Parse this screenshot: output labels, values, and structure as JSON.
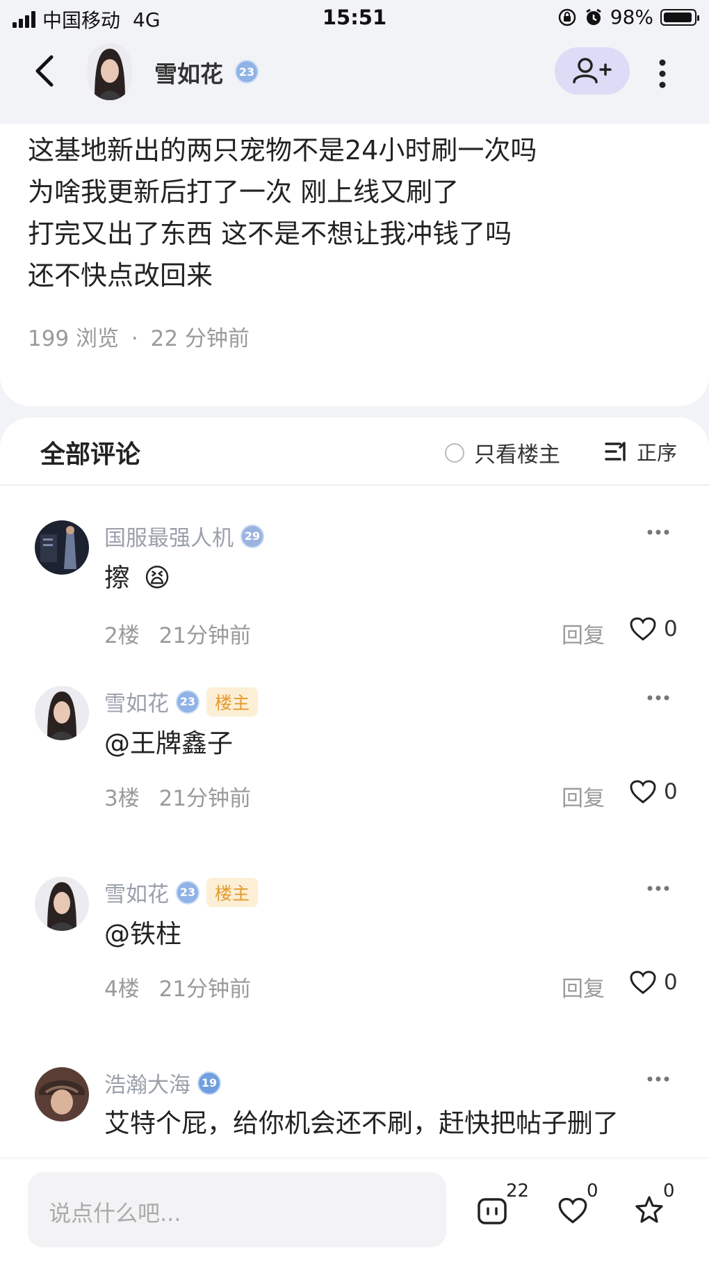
{
  "status": {
    "carrier": "中国移动",
    "network": "4G",
    "time": "15:51",
    "battery": "98%"
  },
  "header": {
    "username": "雪如花",
    "level": "23",
    "avatar_icon": "female-portrait-avatar",
    "follow_icon": "add-user-icon"
  },
  "post": {
    "lines": [
      "这基地新出的两只宠物不是24小时刷一次吗",
      "为啥我更新后打了一次 刚上线又刷了",
      "打完又出了东西 这不是不想让我冲钱了吗",
      "还不快点改回来"
    ],
    "views": "199 浏览",
    "separator": "·",
    "time": "22 分钟前"
  },
  "comments_section": {
    "title": "全部评论",
    "only_op_label": "只看楼主",
    "sort_label": "正序",
    "items": [
      {
        "name": "国服最强人机",
        "level": "29",
        "level_color": "#9cb3e0",
        "is_op": false,
        "text": "擦",
        "emoji": "😫",
        "floor": "2楼",
        "time": "21分钟前",
        "reply": "回复",
        "likes": "0",
        "avatar_color": "#1d2230"
      },
      {
        "name": "雪如花",
        "level": "23",
        "level_color": "#8fb3e6",
        "is_op": true,
        "op_label": "楼主",
        "text": "@王牌鑫子",
        "floor": "3楼",
        "time": "21分钟前",
        "reply": "回复",
        "likes": "0",
        "avatar_color": "#e9e9ee"
      },
      {
        "name": "雪如花",
        "level": "23",
        "level_color": "#8fb3e6",
        "is_op": true,
        "op_label": "楼主",
        "text": "@铁柱",
        "floor": "4楼",
        "time": "21分钟前",
        "reply": "回复",
        "likes": "0",
        "avatar_color": "#e9e9ee"
      },
      {
        "name": "浩瀚大海",
        "level": "19",
        "level_color": "#6f9fe0",
        "is_op": false,
        "text": "艾特个屁，给你机会还不刷，赶快把帖子删了",
        "avatar_color": "#5a3e36"
      }
    ]
  },
  "bottom_bar": {
    "placeholder": "说点什么吧...",
    "comment_count": "22",
    "like_count": "0",
    "favorite_count": "0"
  }
}
